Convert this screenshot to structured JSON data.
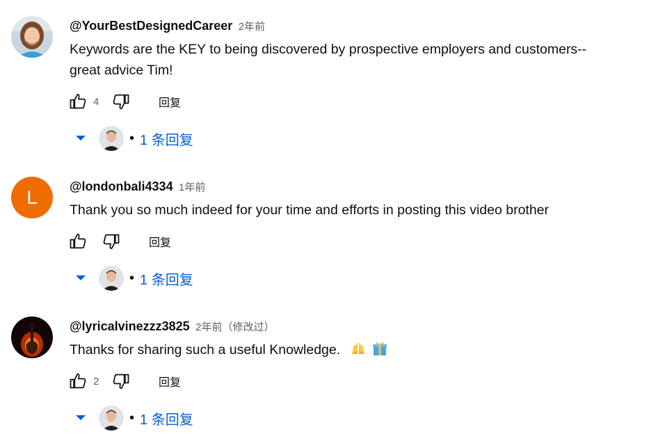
{
  "comments": [
    {
      "avatar": {
        "type": "photo",
        "icon": "woman-portrait"
      },
      "author": "@YourBestDesignedCareer",
      "time": "2年前",
      "text": "Keywords are the KEY to being discovered by prospective employers and customers--\ngreat advice Tim!",
      "likes": "4",
      "reply_label": "回复",
      "replies_label": "1 条回复"
    },
    {
      "avatar": {
        "type": "letter",
        "letter": "L",
        "color": "#ef6c00"
      },
      "author": "@londonbali4334",
      "time": "1年前",
      "text": "Thank you so much indeed for your time and efforts in posting this video brother",
      "likes": "",
      "reply_label": "回复",
      "replies_label": "1 条回复"
    },
    {
      "avatar": {
        "type": "photo",
        "icon": "guitar-fire"
      },
      "author": "@lyricalvinezzz3825",
      "time": "2年前（修改过）",
      "text": "Thanks for sharing such a useful Knowledge.",
      "emojis": [
        "raising-hands-emoji",
        "gift-emoji"
      ],
      "likes": "2",
      "reply_label": "回复",
      "replies_label": "1 条回复"
    }
  ],
  "reply_creator_avatar_icon": "man-portrait",
  "colors": {
    "link": "#065fd4",
    "secondary_text": "#606060",
    "letter_avatar": "#ef6c00"
  }
}
